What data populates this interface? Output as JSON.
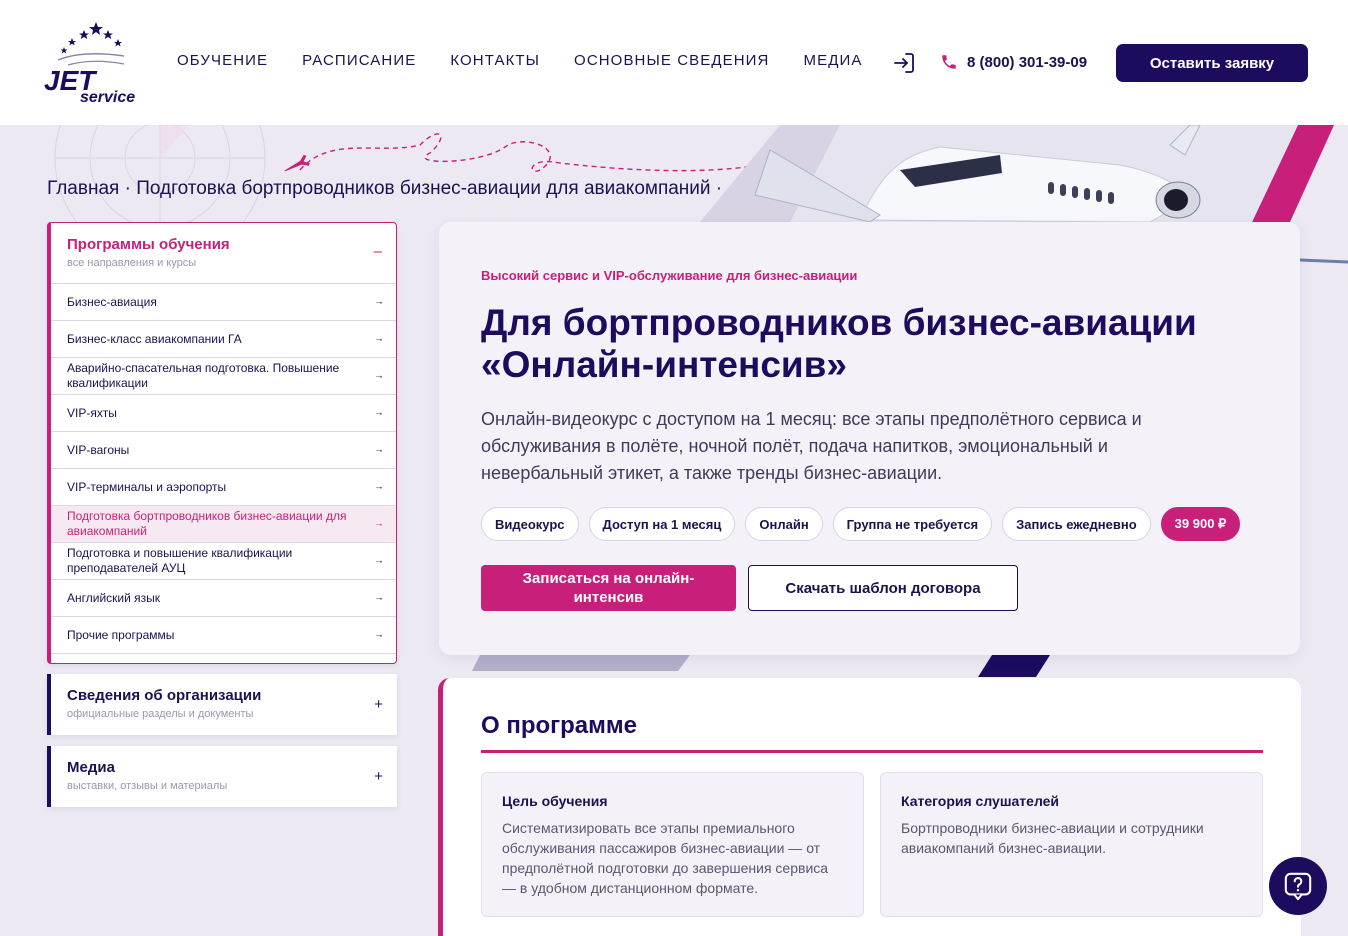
{
  "logo": {
    "line1": "JET",
    "line2": "service"
  },
  "nav": {
    "items": [
      "ОБУЧЕНИЕ",
      "РАСПИСАНИЕ",
      "КОНТАКТЫ",
      "ОСНОВНЫЕ СВЕДЕНИЯ",
      "МЕДИА"
    ],
    "login_icon": "login-arrow-icon",
    "phone_icon": "phone-icon",
    "phone": "8 (800) 301-39-09",
    "cta": "Оставить заявку"
  },
  "breadcrumb": "Главная · Подготовка бортпроводников бизнес-авиации для авиакомпаний ·",
  "sidebar": {
    "programs": {
      "title": "Программы обучения",
      "subtitle": "все направления и курсы",
      "toggle": "–",
      "items": [
        {
          "label": "Бизнес-авиация"
        },
        {
          "label": "Бизнес-класс авиакомпании ГА"
        },
        {
          "label": "Аварийно-спасательная подготовка. Повышение квалификации"
        },
        {
          "label": "VIP-яхты"
        },
        {
          "label": "VIP-вагоны"
        },
        {
          "label": "VIP-терминалы и аэропорты"
        },
        {
          "label": "Подготовка бортпроводников бизнес-авиации для авиакомпаний",
          "active": true
        },
        {
          "label": "Подготовка и повышение квалификации преподавателей АУЦ"
        },
        {
          "label": "Английский язык"
        },
        {
          "label": "Прочие программы"
        }
      ],
      "arrow": "→"
    },
    "org": {
      "title": "Сведения об организации",
      "subtitle": "официальные разделы и документы",
      "toggle": "+"
    },
    "media": {
      "title": "Медиа",
      "subtitle": "выставки, отзывы и материалы",
      "toggle": "+"
    }
  },
  "hero": {
    "eyebrow": "Высокий сервис и VIP-обслуживание для бизнес-авиации",
    "title": "Для бортпроводников бизнес-авиации «Онлайн-интенсив»",
    "description": "Онлайн-видеокурс с доступом на 1 месяц: все этапы предполётного сервиса и обслуживания в полёте, ночной полёт, подача напитков, эмоциональный и невербальный этикет, а также тренды бизнес-авиации.",
    "chips": [
      "Видеокурс",
      "Доступ на 1 месяц",
      "Онлайн",
      "Группа не требуется",
      "Запись ежедневно"
    ],
    "price": "39 900 ₽",
    "primary_button": "Записаться на онлайн-интенсив",
    "secondary_button": "Скачать шаблон договора"
  },
  "about": {
    "title": "О программе",
    "cards": [
      {
        "title": "Цель обучения",
        "text": "Систематизировать все этапы премиального обслуживания пассажиров бизнес-авиации — от предполётной подготовки до завершения сервиса — в удобном дистанционном формате."
      },
      {
        "title": "Категория слушателей",
        "text": "Бортпроводники бизнес-авиации и сотрудники авиакомпаний бизнес-авиации."
      }
    ]
  },
  "help_icon": "question-chat-icon",
  "colors": {
    "brand_navy": "#1d0c5e",
    "accent_magenta": "#c8207a",
    "page_bg": "#ece9f3"
  }
}
